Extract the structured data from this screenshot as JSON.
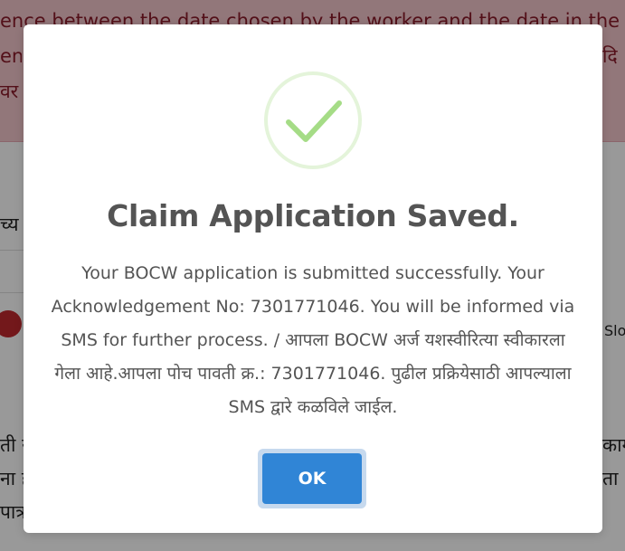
{
  "background": {
    "alert_lines": [
      "ence between the date chosen by the worker and the date in the let",
      "ent",
      "दि",
      "वर"
    ],
    "left_fragments": [
      "च्य",
      "ती र",
      "ना ह",
      "पात्र"
    ],
    "right_fragments": [
      "Slo",
      "काग",
      "ता"
    ]
  },
  "modal": {
    "icon": "success-checkmark-icon",
    "title": "Claim Application Saved.",
    "message": "Your BOCW application is submitted successfully. Your Acknowledgement No: 7301771046. You will be informed via SMS for further process. / आपला BOCW अर्ज यशस्वीरित्या स्वीकारला गेला आहे.आपला पोच पावती क्र.: 7301771046. पुढील प्रक्रियेसाठी आपल्याला SMS द्वारे कळविले जाईल.",
    "ok_label": "OK"
  },
  "colors": {
    "confirm_button": "#3085d6",
    "success_icon": "#a5dc86",
    "alert_background": "#f4c6cc",
    "overlay": "rgba(0,0,0,0.4)"
  }
}
